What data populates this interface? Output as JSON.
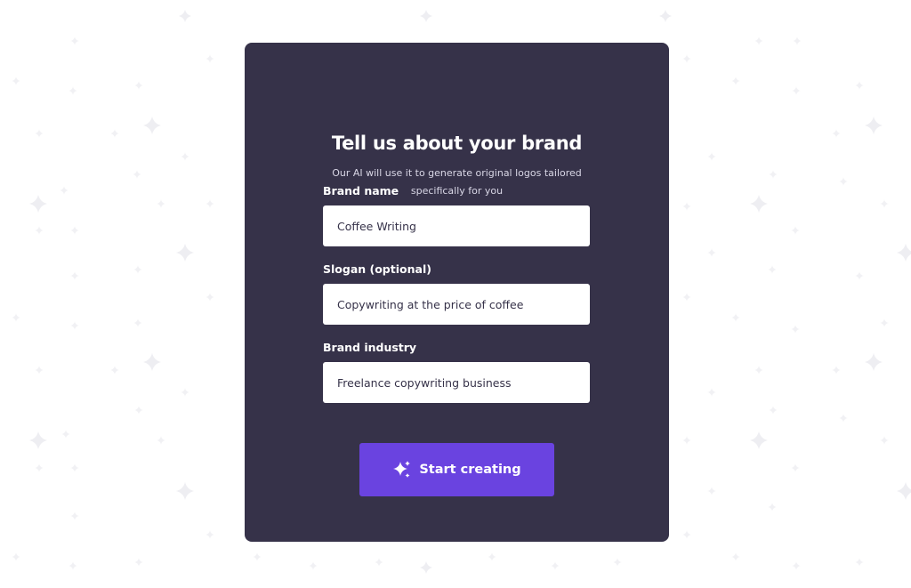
{
  "form": {
    "title": "Tell us about your brand",
    "subtitle_line1": "Our AI will use it to generate original logos tailored",
    "subtitle_line2": "specifically for you",
    "fields": [
      {
        "label": "Brand name",
        "value": "Coffee Writing"
      },
      {
        "label": "Slogan (optional)",
        "value": "Copywriting at the price of coffee"
      },
      {
        "label": "Brand industry",
        "value": "Freelance copywriting business"
      }
    ],
    "submit_label": "Start creating",
    "submit_icon": "sparkles-icon"
  },
  "colors": {
    "page_background": "#ffffff",
    "card_background": "#363249",
    "input_background": "#ffffff",
    "button_background": "#6a43e0",
    "text_light": "#ffffff",
    "sparkle_decoration": "#eeeef2"
  }
}
